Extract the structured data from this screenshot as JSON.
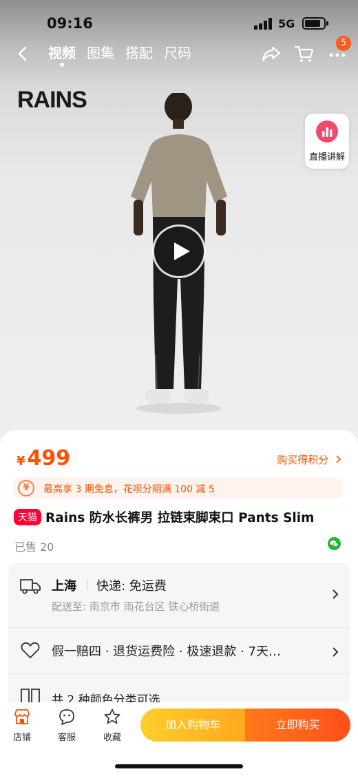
{
  "status_bar": {
    "time": "09:16",
    "network": "5G"
  },
  "nav": {
    "tabs": [
      {
        "label": "视频",
        "active": true
      },
      {
        "label": "图集",
        "active": false
      },
      {
        "label": "搭配",
        "active": false
      },
      {
        "label": "尺码",
        "active": false
      }
    ],
    "more_badge": "5"
  },
  "hero": {
    "brand_logo": "RAINS",
    "live_button_label": "直播讲解"
  },
  "product": {
    "currency": "¥",
    "price": "499",
    "points_link": "购买得积分",
    "promo_icon": "¥",
    "promo_text": "最高享 3 期免息，花呗分期满 100 减 5",
    "store_tag": "天猫",
    "title": "Rains 防水长裤男 拉链束脚束口 Pants Slim",
    "sold_count": "已售 20"
  },
  "services": {
    "shipping": {
      "city": "上海",
      "express": "快递: 免运费",
      "address": "配送至: 南京市 雨花台区 铁心桥街道"
    },
    "guarantee": "假一赔四 · 退货运费险 · 极速退款 · 7天…",
    "options_partial": "共 2 种颜色分类可选"
  },
  "bottom_bar": {
    "store_label": "店铺",
    "service_label": "客服",
    "favorite_label": "收藏",
    "add_to_cart": "加入购物车",
    "buy_now": "立即购买"
  },
  "colors": {
    "accent": "#ff5000",
    "tmall_red": "#ff0036",
    "cart_yellow": "#ffb320",
    "buy_orange": "#ff5a1a"
  },
  "icons": [
    "back-icon",
    "share-icon",
    "cart-icon",
    "more-icon",
    "live-chart-icon",
    "play-icon",
    "truck-icon",
    "heart-shield-icon",
    "store-icon",
    "service-chat-icon",
    "star-icon",
    "wechat-icon"
  ]
}
